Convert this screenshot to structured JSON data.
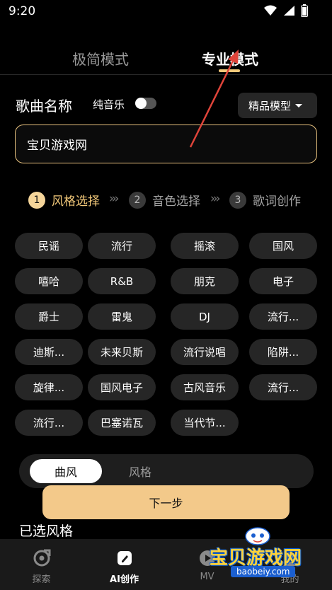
{
  "status_bar": {
    "time": "9:20",
    "icons": [
      "wifi-icon",
      "signal-icon",
      "battery-icon"
    ]
  },
  "mode_tabs": {
    "simple": "极简模式",
    "pro": "专业模式",
    "active": "pro"
  },
  "song": {
    "name_label": "歌曲名称",
    "pure_music_label": "纯音乐",
    "pure_music_on": false,
    "model_select": "精品模型",
    "name_value": "宝贝游戏网"
  },
  "steps": [
    {
      "num": "1",
      "label": "风格选择",
      "active": true
    },
    {
      "num": "2",
      "label": "音色选择",
      "active": false
    },
    {
      "num": "3",
      "label": "歌词创作",
      "active": false
    }
  ],
  "styles": [
    "民谣",
    "流行",
    "摇滚",
    "国风",
    "嘻哈",
    "R&B",
    "朋克",
    "电子",
    "爵士",
    "雷鬼",
    "DJ",
    "流行...",
    "迪斯...",
    "未来贝斯",
    "流行说唱",
    "陷阱...",
    "旋律...",
    "国风电子",
    "古风音乐",
    "流行...",
    "流行...",
    "巴塞诺瓦",
    "当代节..."
  ],
  "sub_tabs": {
    "active": "曲风",
    "inactive": "风格"
  },
  "next_button": "下一步",
  "selected_title": "已选风格",
  "bottom_nav": [
    {
      "label": "探索",
      "icon": "explore-icon",
      "active": false
    },
    {
      "label": "AI创作",
      "icon": "ai-create-icon",
      "active": true
    },
    {
      "label": "MV",
      "icon": "mv-play-icon",
      "active": false
    },
    {
      "label": "我的",
      "icon": "profile-icon",
      "active": false
    }
  ],
  "watermark": {
    "text": "宝贝游戏网",
    "url": "baobeiy.com"
  },
  "colors": {
    "accent": "#f3c97a",
    "chip_bg": "#262626",
    "background": "#000000",
    "next_button": "#f3c98a",
    "arrow": "#e0443a"
  }
}
